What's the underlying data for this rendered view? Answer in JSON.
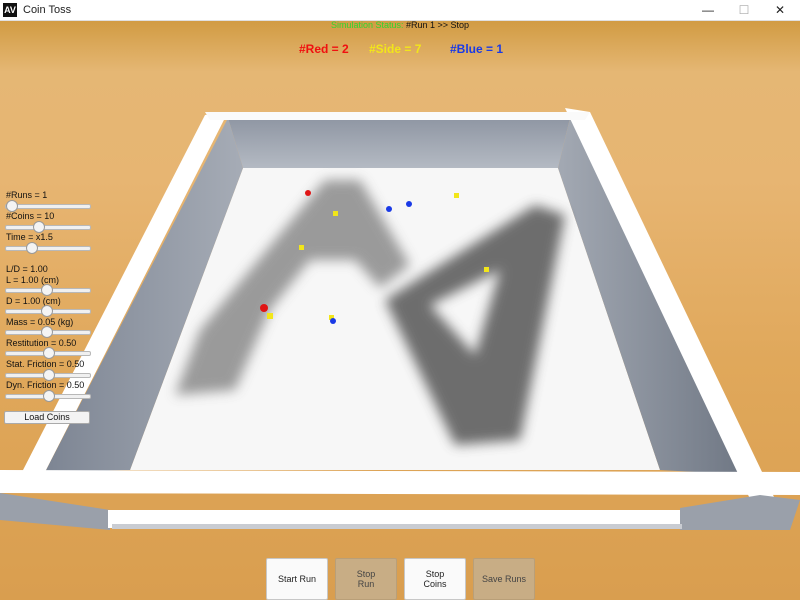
{
  "window": {
    "title": "Coin Toss",
    "icon_glyph": "AV",
    "minimize_glyph": "—",
    "maximize_glyph": "☐",
    "close_glyph": "✕"
  },
  "status": {
    "label": "Simulation Status:",
    "value": "#Run 1 >>  Stop"
  },
  "counts": {
    "red": "#Red = 2",
    "side": "#Side = 7",
    "blue": "#Blue = 1"
  },
  "controls": {
    "runs": {
      "label": "#Runs = 1",
      "fraction": 0.0
    },
    "coins": {
      "label": "#Coins = 10",
      "fraction": 0.37
    },
    "time": {
      "label": "Time = x1.5",
      "fraction": 0.27
    },
    "ld": {
      "label": "L/D = 1.00"
    },
    "l": {
      "label": "L = 1.00 (cm)",
      "fraction": 0.47
    },
    "d": {
      "label": "D = 1.00 (cm)",
      "fraction": 0.47
    },
    "mass": {
      "label": "Mass = 0.05 (kg)",
      "fraction": 0.47
    },
    "restitution": {
      "label": "Restitution = 0.50",
      "fraction": 0.5
    },
    "stat_friction": {
      "label": "Stat. Friction = 0.50",
      "fraction": 0.5
    },
    "dyn_friction": {
      "label": "Dyn. Friction = 0.50",
      "fraction": 0.5
    },
    "load_coins": "Load Coins"
  },
  "buttons": {
    "start_run": "Start Run",
    "stop_run": "Stop\nRun",
    "stop_coins": "Stop\nCoins",
    "save_runs": "Save Runs"
  },
  "colors": {
    "red": "#f01010",
    "side": "#f2e61a",
    "blue": "#1a3ae6",
    "status_label": "#2ed62e"
  }
}
